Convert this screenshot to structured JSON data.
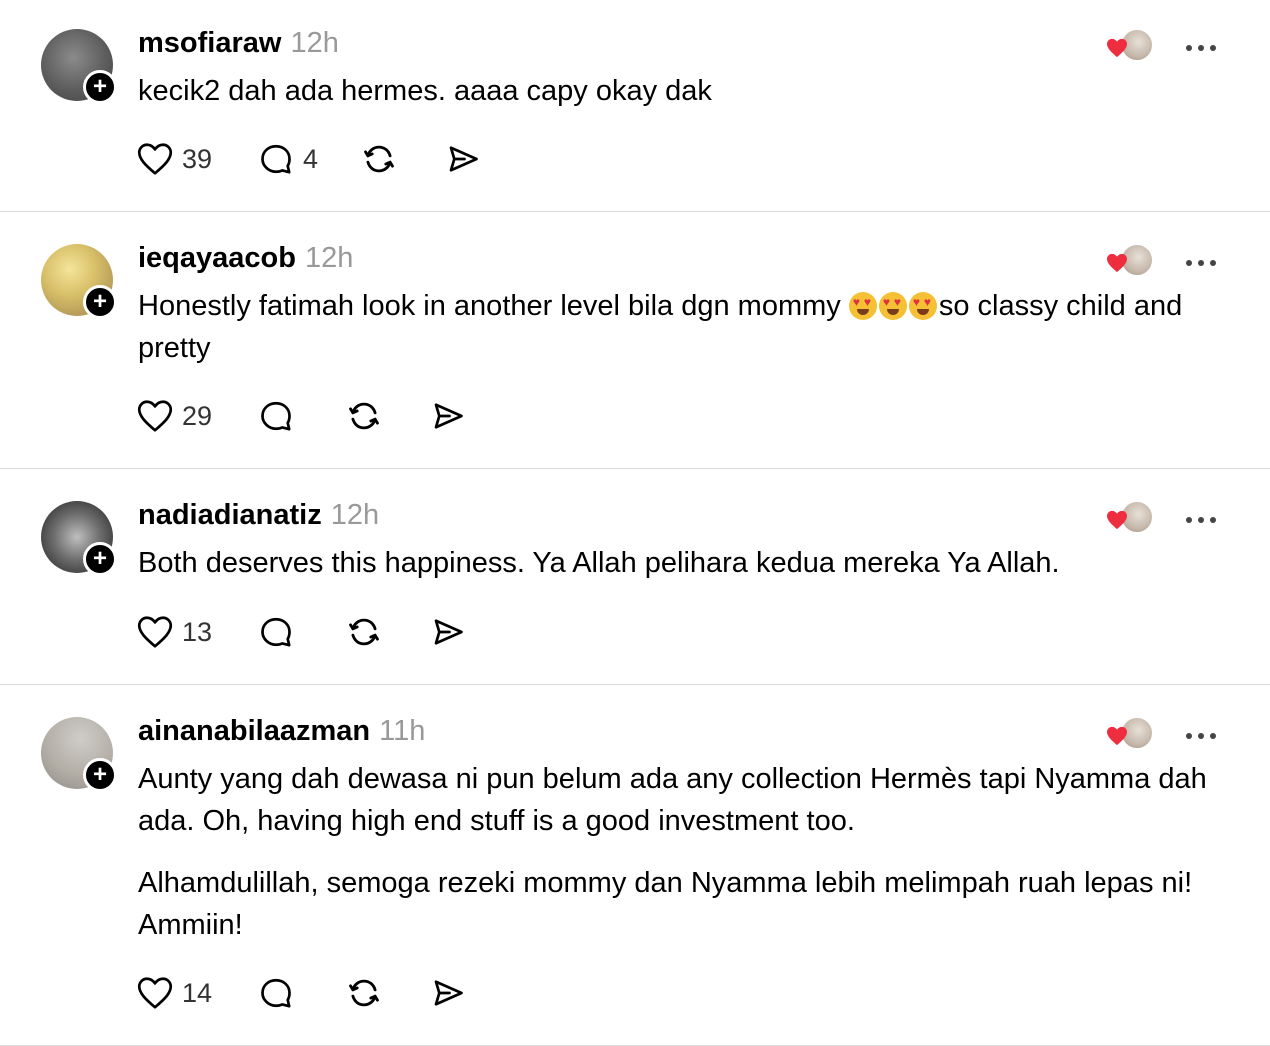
{
  "posts": [
    {
      "username": "msofiaraw",
      "time": "12h",
      "paragraphs": [
        "kecik2 dah ada hermes. aaaa capy okay dak"
      ],
      "likes": "39",
      "replies": "4"
    },
    {
      "username": "ieqayaacob",
      "time": "12h",
      "text_before_emoji": "Honestly fatimah look in another level bila dgn mommy ",
      "emojis": [
        "heart-eyes",
        "heart-eyes",
        "heart-eyes"
      ],
      "text_after_emoji": "so classy child and pretty",
      "likes": "29",
      "replies": ""
    },
    {
      "username": "nadiadianatiz",
      "time": "12h",
      "paragraphs": [
        "Both deserves this happiness. Ya Allah pelihara kedua mereka Ya Allah."
      ],
      "likes": "13",
      "replies": ""
    },
    {
      "username": "ainanabilaazman",
      "time": "11h",
      "paragraphs": [
        "Aunty yang dah dewasa ni pun belum ada any collection Hermès tapi Nyamma dah ada. Oh, having high end stuff is a good investment too.",
        "Alhamdulillah, semoga rezeki mommy dan Nyamma lebih melimpah ruah lepas ni! Ammiin!"
      ],
      "likes": "14",
      "replies": ""
    }
  ],
  "icons": {
    "like": "heart-outline-icon",
    "reply": "speech-bubble-icon",
    "repost": "repost-arrows-icon",
    "share": "send-paper-plane-icon",
    "more": "more-dots-icon",
    "follow": "plus-icon",
    "liked_by_author": "red-heart-icon"
  },
  "colors": {
    "text": "#000000",
    "muted": "#999999",
    "divider": "#dadada",
    "heart": "#ee2d3e"
  }
}
